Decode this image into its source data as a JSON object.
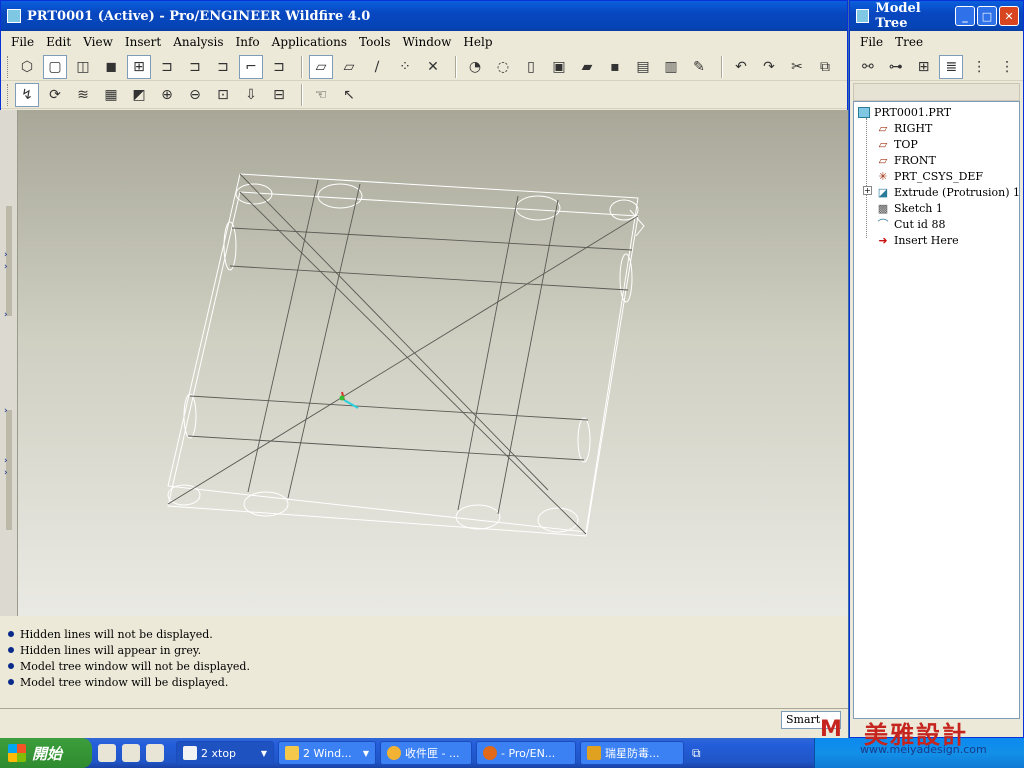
{
  "main_window": {
    "title": "PRT0001 (Active) - Pro/ENGINEER Wildfire 4.0",
    "menu": [
      "File",
      "Edit",
      "View",
      "Insert",
      "Analysis",
      "Info",
      "Applications",
      "Tools",
      "Window",
      "Help"
    ]
  },
  "toolbar_icons": {
    "row1": [
      "cube-icon",
      "cube-front-icon",
      "cube-shaded-icon",
      "cube-filled-icon",
      "datum-display-icon",
      "hidden-line-icon",
      "no-hidden-icon",
      "shading-icon",
      "sketch-filter-icon",
      "select-icon",
      "plane-icon",
      "axis-icon",
      "point-icon",
      "csys-icon",
      "repaint-icon",
      "orient-icon",
      "new-file-icon",
      "open-icon",
      "folder-icon",
      "save-icon",
      "save-copy-icon",
      "print-icon",
      "pen-icon",
      "undo-icon",
      "redo-icon",
      "cut-icon",
      "copy-icon"
    ],
    "row2": [
      "trim-icon",
      "regenerate-icon",
      "layers-icon",
      "saved-views-icon",
      "zoom-area-icon",
      "zoom-in-icon",
      "zoom-out-icon",
      "refit-icon",
      "orient-view-icon",
      "named-view-icon",
      "hand-icon",
      "help-arrow-icon"
    ]
  },
  "messages": [
    "Hidden lines will not be displayed.",
    "Hidden lines will appear in grey.",
    "Model tree window will not be displayed.",
    "Model tree window will be displayed."
  ],
  "status": {
    "filter": "Smart"
  },
  "tree_window": {
    "title": "Model Tree",
    "menu": [
      "File",
      "Tree"
    ],
    "items": [
      {
        "label": "PRT0001.PRT",
        "icon": "part-icon"
      },
      {
        "label": "RIGHT",
        "icon": "datum-plane-icon"
      },
      {
        "label": "TOP",
        "icon": "datum-plane-icon"
      },
      {
        "label": "FRONT",
        "icon": "datum-plane-icon"
      },
      {
        "label": "PRT_CSYS_DEF",
        "icon": "csys-icon"
      },
      {
        "label": "Extrude (Protrusion) 1",
        "icon": "extrude-icon"
      },
      {
        "label": "Sketch 1",
        "icon": "sketch-icon"
      },
      {
        "label": "Cut id 88",
        "icon": "cut-icon"
      },
      {
        "label": "Insert Here",
        "icon": "insert-here-icon"
      }
    ]
  },
  "taskbar": {
    "start_label": "開始",
    "buttons": [
      "2 xtop",
      "2 Wind...",
      "收件匣 - ...",
      "- Pro/EN...",
      "瑞星防毒..."
    ]
  },
  "watermark": {
    "brand": "美雅設計",
    "url": "www.meiyadesign.com"
  },
  "colors": {
    "title_blue": "#0847c1",
    "wireframe": "#ffffff",
    "background_top": "#a8a798",
    "background_bottom": "#eaeae4"
  }
}
